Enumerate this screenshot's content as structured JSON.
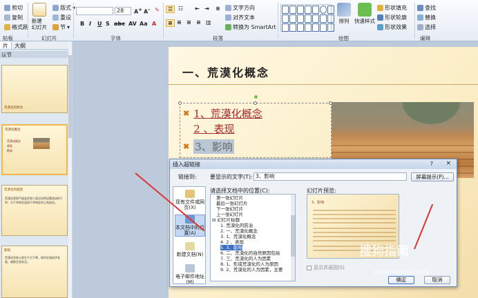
{
  "ribbon": {
    "clipboard": {
      "cut": "剪切",
      "copy": "复制",
      "format_painter": "格式刷",
      "label": "贴板"
    },
    "slides": {
      "new_slide": "新建\n幻灯片",
      "layout": "版式",
      "reset": "重设",
      "section": "节",
      "label": "幻灯片"
    },
    "font": {
      "size": "28",
      "label": "字体"
    },
    "paragraph": {
      "text_direction": "文字方向",
      "align_text": "对齐文本",
      "convert_smartart": "转换为 SmartArt",
      "label": "段落"
    },
    "drawing": {
      "arrange": "排列",
      "quick_styles": "快速样式",
      "shape_fill": "形状填充",
      "shape_outline": "形状轮廓",
      "shape_effects": "形状效果",
      "label": "绘图"
    },
    "editing": {
      "find": "查找",
      "replace": "替换",
      "select": "选择",
      "label": "编辑"
    }
  },
  "left_panel": {
    "tabs": [
      "片",
      "大纲"
    ],
    "section": "认节",
    "thumbs": [
      {
        "title": "荒漠化的防治"
      },
      {
        "title": "荒漠化概念",
        "bullets": [
          "荒漠化概念",
          "表现",
          "影响"
        ]
      },
      {
        "title": "荒漠化的成因",
        "text": "荒漠化是指气候变异和人类活动等因素造成的干旱、半干旱和亚湿润干旱地区的土地退化。"
      },
      {
        "title": "影响",
        "text": "荒漠化导致土地生产力下降，制约区域经济发展，威胁生态安全。"
      }
    ]
  },
  "slide": {
    "title": "一、荒漠化概念",
    "bullets": [
      "1、荒漠化概念",
      "2 、表现",
      "3、影响"
    ]
  },
  "dialog": {
    "title": "插入超链接",
    "help": "?",
    "close": "×",
    "link_to_label": "链接到:",
    "display_text_label": "要显示的文字(T):",
    "display_text_value": "3、影响",
    "screentip_button": "屏幕提示(P)...",
    "place_label": "请选择文档中的位置(C):",
    "preview_label": "幻灯片预览:",
    "link_options": [
      "现有文件或网页(X)",
      "本文档中的位置(A)",
      "新建文档(N)",
      "电子邮件地址(M)"
    ],
    "tree": [
      "第一张幻灯片",
      "最后一张幻灯片",
      "下一张幻灯片",
      "上一张幻灯片",
      "幻灯片标题",
      "1. 荒漠化的防治",
      "2. 一、荒漠化概念",
      "3. 1、荒漠化概念",
      "4. 2 、表现",
      "5. 3、影响",
      "6. 二、荒漠化的自然原因包括",
      "7. 三、荒漠化的人为因素",
      "8. 1、形成荒漠化的人为原因",
      "9. 2、荒漠化的人为因素，主要"
    ],
    "preview_title": "3、影响",
    "show_all": "显示并返回(S)",
    "ok": "确定",
    "cancel": "取消"
  },
  "watermark": {
    "main": "搜狗指南",
    "url": "zhinan.sogou.com"
  }
}
